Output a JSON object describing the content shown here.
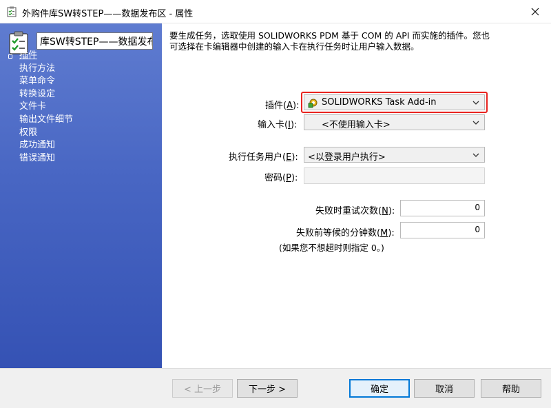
{
  "window": {
    "title": "外购件库SW转STEP——数据发布区 - 属性",
    "close_glyph": "✕"
  },
  "sidebar": {
    "task_name": "库SW转STEP——数据发布区",
    "items": [
      {
        "label": "插件",
        "active": true
      },
      {
        "label": "执行方法",
        "active": false
      },
      {
        "label": "菜单命令",
        "active": false
      },
      {
        "label": "转换设定",
        "active": false
      },
      {
        "label": "文件卡",
        "active": false
      },
      {
        "label": "输出文件细节",
        "active": false
      },
      {
        "label": "权限",
        "active": false
      },
      {
        "label": "成功通知",
        "active": false
      },
      {
        "label": "错误通知",
        "active": false
      }
    ]
  },
  "main": {
    "description_line1": "要生成任务，选取使用 SOLIDWORKS PDM 基于 COM 的 API 而实施的插件。您也",
    "description_line2": "可选择在卡编辑器中创建的输入卡在执行任务时让用户输入数据。",
    "plugin": {
      "label": "插件",
      "accel": "A",
      "value": "SOLIDWORKS Task Add-in",
      "icon": "gear-puzzle-icon"
    },
    "input_card": {
      "label": "输入卡",
      "accel": "I",
      "value": "<不使用输入卡>"
    },
    "run_as": {
      "label": "执行任务用户",
      "accel": "E",
      "value": "<以登录用户执行>"
    },
    "password": {
      "label": "密码",
      "accel": "P",
      "value": ""
    },
    "retries": {
      "label": "失败时重试次数",
      "accel": "N",
      "value": "0"
    },
    "wait_minutes": {
      "label": "失败前等候的分钟数",
      "accel": "M",
      "value": "0"
    },
    "timeout_note": "(如果您不想超时则指定 0。)"
  },
  "footer": {
    "back": "< 上一步",
    "next": "下一步 >",
    "ok": "确定",
    "cancel": "取消",
    "help": "帮助"
  },
  "colors": {
    "sidebar_top": "#5f7cd0",
    "sidebar_bottom": "#3552b4",
    "highlight": "#e8231f",
    "default_button": "#0078d7"
  }
}
